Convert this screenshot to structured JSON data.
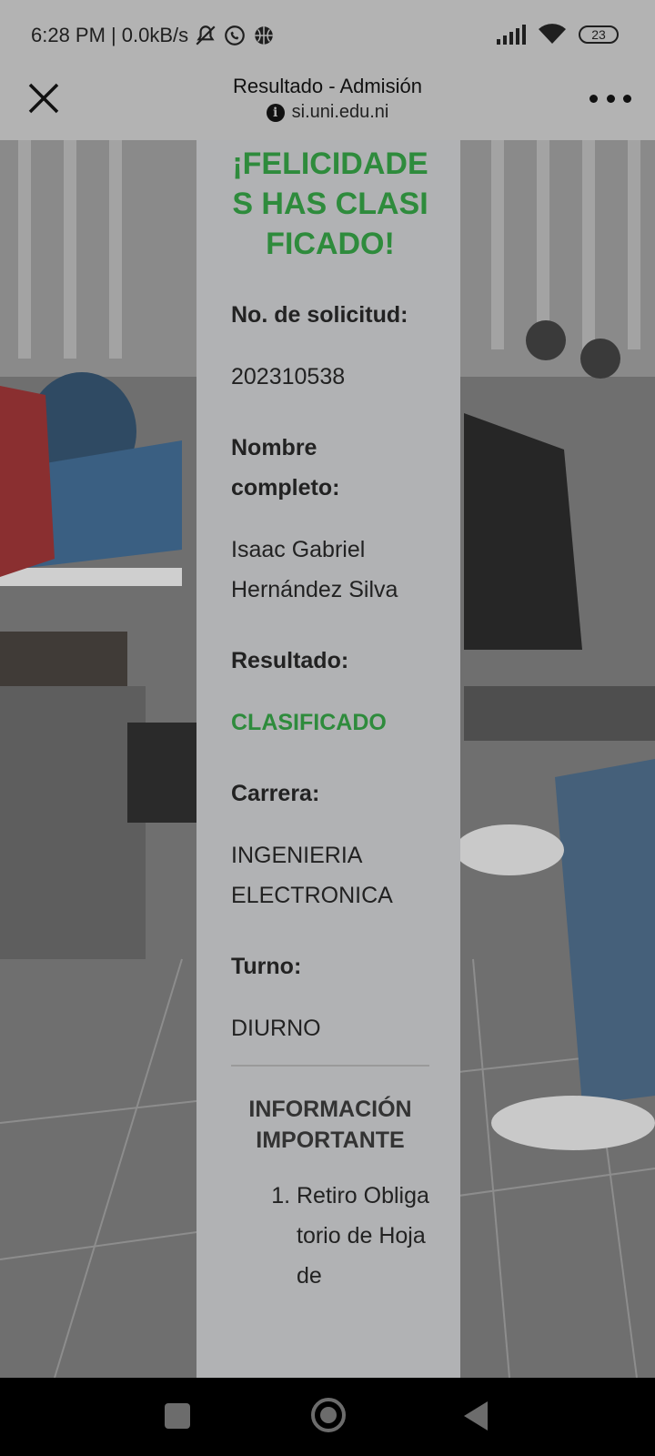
{
  "status_bar": {
    "time": "6:28 PM",
    "network_speed": "| 0.0kB/s",
    "battery": "23",
    "icons": [
      "mute-icon",
      "whatsapp-icon",
      "ball-icon",
      "signal-icon",
      "wifi-icon",
      "battery-icon"
    ]
  },
  "header": {
    "title": "Resultado - Admisión",
    "url": "si.uni.edu.ni",
    "info_glyph": "i"
  },
  "card": {
    "congrats": "¡FELICIDADES HAS CLASIFICADO!",
    "fields": [
      {
        "label": "No. de solicitud:",
        "value": "202310538"
      },
      {
        "label": "Nombre completo:",
        "value": "Isaac Gabriel Hernández Silva"
      },
      {
        "label": "Resultado:",
        "value": "CLASIFICADO"
      },
      {
        "label": "Carrera:",
        "value": "INGENIERIA ELECTRONICA"
      },
      {
        "label": "Turno:",
        "value": "DIURNO"
      }
    ],
    "info_heading": "INFORMACIÓN IMPORTANTE",
    "info_items": [
      "Retiro Obligatorio de Hoja de"
    ]
  },
  "colors": {
    "accent_green": "#2e8b3c",
    "bar_gray": "#b3b3b3"
  }
}
